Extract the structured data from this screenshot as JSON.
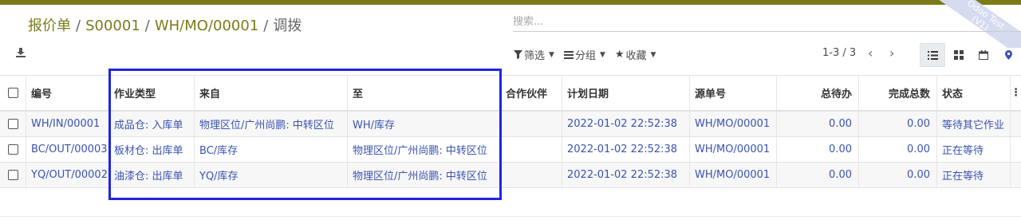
{
  "breadcrumb": {
    "items": [
      "报价单",
      "S00001",
      "WH/MO/00001"
    ],
    "current": "调拨"
  },
  "ribbon": {
    "line1": "Odoo Test",
    "line2": "(V1)"
  },
  "search": {
    "placeholder": "搜索..."
  },
  "filters": {
    "filter_label": "筛选",
    "group_label": "分组",
    "favorites_label": "收藏"
  },
  "pager": {
    "text": "1-3 / 3"
  },
  "table": {
    "headers": [
      "编号",
      "作业类型",
      "来自",
      "至",
      "合作伙伴",
      "计划日期",
      "源单号",
      "总待办",
      "完成总数",
      "状态"
    ],
    "rows": [
      [
        "WH/IN/00001",
        "成品仓: 入库单",
        "物理区位/广州尚鹏: 中转区位",
        "WH/库存",
        "",
        "2022-01-02 22:52:38",
        "WH/MO/00001",
        "0.00",
        "0.00",
        "等待其它作业"
      ],
      [
        "BC/OUT/00003",
        "板材仓: 出库单",
        "BC/库存",
        "物理区位/广州尚鹏: 中转区位",
        "",
        "2022-01-02 22:52:38",
        "WH/MO/00001",
        "0.00",
        "0.00",
        "正在等待"
      ],
      [
        "YQ/OUT/00002",
        "油漆仓: 出库单",
        "YQ/库存",
        "物理区位/广州尚鹏: 中转区位",
        "",
        "2022-01-02 22:52:38",
        "WH/MO/00001",
        "0.00",
        "0.00",
        "正在等待"
      ]
    ]
  },
  "colors": {
    "brand": "#7c7b18",
    "link": "#3a53b1",
    "highlight_box": "#1f25e3"
  }
}
